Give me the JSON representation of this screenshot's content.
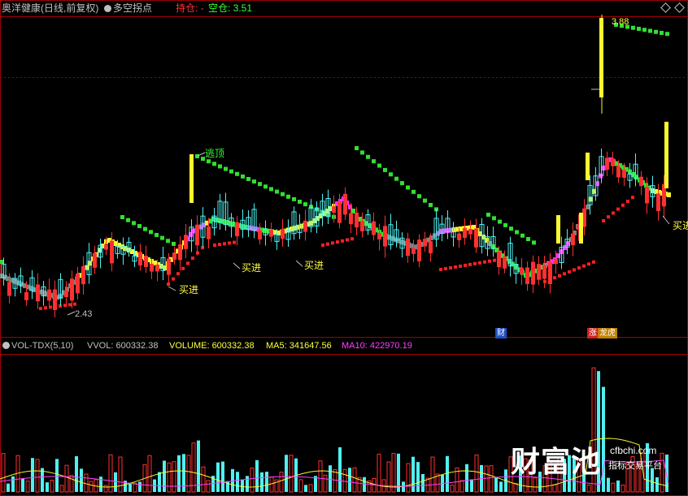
{
  "header": {
    "stock_title": "奥洋健康(日线,前复权)",
    "indicator_name": "多空拐点",
    "hold_label": "持仓: -",
    "empty_label": "空仓: 3.51",
    "colors": {
      "title": "#c0c0c0",
      "hold": "#ff3030",
      "empty": "#30ff30"
    }
  },
  "main_chart": {
    "annotations": {
      "high_value": "3.88",
      "low_value": "2.43",
      "escape_top": "逃顶",
      "buy_labels": [
        "买进",
        "买进",
        "买进",
        "买进"
      ]
    },
    "markers": {
      "finance": "财",
      "limit_up": "涨",
      "dragon_tiger": "龙虎"
    }
  },
  "volume_panel": {
    "name": "VOL-TDX(5,10)",
    "vvol": "VVOL: 600332.38",
    "volume": "VOLUME: 600332.38",
    "ma5": "MA5: 341647.56",
    "ma10": "MA10: 422970.19",
    "colors": {
      "vvol": "#c0c0c0",
      "volume": "#ffff40",
      "ma5": "#ffff40",
      "ma10": "#ff40ff"
    }
  },
  "watermark": {
    "brand": "财富池",
    "domain": "cfbchi.com",
    "slogan": "指标交易平台"
  }
}
